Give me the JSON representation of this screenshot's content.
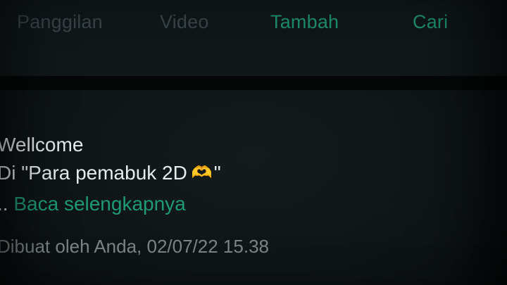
{
  "tabs": [
    {
      "label": "Panggilan",
      "active": false
    },
    {
      "label": "Video",
      "active": false
    },
    {
      "label": "Tambah",
      "active": true
    },
    {
      "label": "Cari",
      "active": true
    }
  ],
  "colors": {
    "accent": "#1f8f6e",
    "muted_tab": "#3a4549",
    "text": "#e6ecea",
    "meta_text": "#7b8683",
    "background": "#0f1517"
  },
  "description": {
    "line1": "Wellcome",
    "line2": "Di \"Para pemabuk 2D",
    "heart_icon": "heart-hands-icon",
    "heart_glyph": "🫶",
    "line2_end": "\"",
    "line3_prefix": "..",
    "read_more": "Baca selengkapnya"
  },
  "meta": {
    "created_by": "Dibuat oleh Anda, 02/07/22 15.38"
  }
}
